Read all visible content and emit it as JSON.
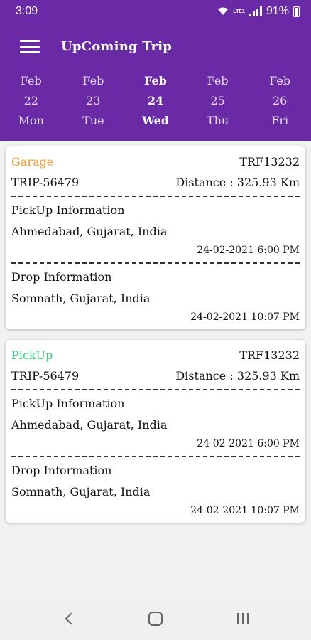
{
  "status_bar": {
    "time": "3:09",
    "battery": "91%",
    "network": "LTE1"
  },
  "app_bar": {
    "title": "UpComing Trip"
  },
  "dates": [
    {
      "month": "Feb",
      "day": "22",
      "weekday": "Mon",
      "selected": false
    },
    {
      "month": "Feb",
      "day": "23",
      "weekday": "Tue",
      "selected": false
    },
    {
      "month": "Feb",
      "day": "24",
      "weekday": "Wed",
      "selected": true
    },
    {
      "month": "Feb",
      "day": "25",
      "weekday": "Thu",
      "selected": false
    },
    {
      "month": "Feb",
      "day": "26",
      "weekday": "Fri",
      "selected": false
    }
  ],
  "trips": [
    {
      "status": "Garage",
      "status_color": "#f39a2b",
      "code": "TRF13232",
      "trip_id": "TRIP-56479",
      "distance": "Distance : 325.93 Km",
      "pickup_heading": "PickUp Information",
      "pickup_location": "Ahmedabad, Gujarat, India",
      "pickup_time": "24-02-2021 6:00 PM",
      "drop_heading": "Drop Information",
      "drop_location": "Somnath, Gujarat, India",
      "drop_time": "24-02-2021 10:07 PM"
    },
    {
      "status": "PickUp",
      "status_color": "#3ccf7a",
      "code": "TRF13232",
      "trip_id": "TRIP-56479",
      "distance": "Distance : 325.93 Km",
      "pickup_heading": "PickUp Information",
      "pickup_location": "Ahmedabad, Gujarat, India",
      "pickup_time": "24-02-2021 6:00 PM",
      "drop_heading": "Drop Information",
      "drop_location": "Somnath, Gujarat, India",
      "drop_time": "24-02-2021 10:07 PM"
    }
  ],
  "colors": {
    "header": "#6a2aa6",
    "pickup_location": "#3ccf7a",
    "drop_location": "#e8232a"
  }
}
